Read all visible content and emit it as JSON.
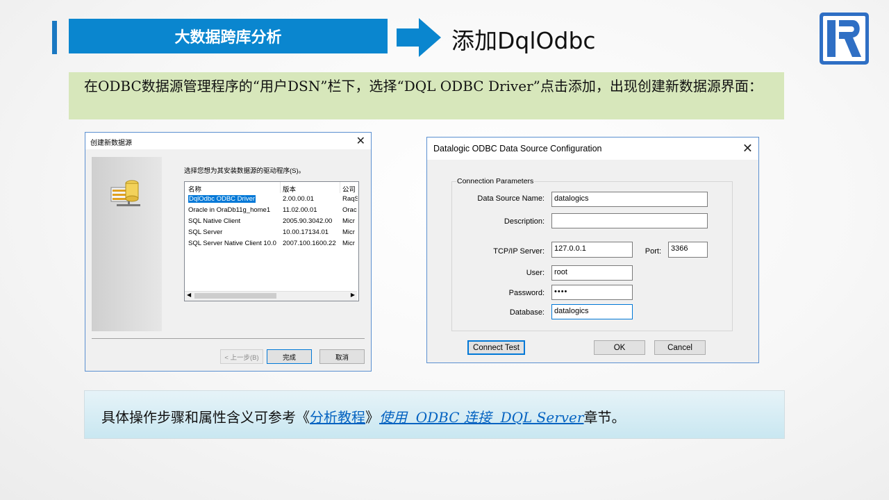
{
  "header": {
    "section_title": "大数据跨库分析",
    "slide_title": "添加DqlOdbc",
    "colors": {
      "accent": "#1a78c2",
      "banner": "#0a86cf",
      "logo": "#2f6fc4"
    }
  },
  "instruction": {
    "text": "在ODBC数据源管理程序的“用户DSN”栏下，选择“DQL ODBC Driver”点击添加，出现创建新数据源界面："
  },
  "new_datasource_dialog": {
    "title": "创建新数据源",
    "prompt": "选择您想为其安装数据源的驱动程序(S)。",
    "columns": [
      "名称",
      "版本",
      "公司"
    ],
    "drivers": [
      {
        "name": "DqlOdbc ODBC Driver",
        "version": "2.00.00.01",
        "company": "RaqS"
      },
      {
        "name": "Oracle in OraDb11g_home1",
        "version": "11.02.00.01",
        "company": "Orac"
      },
      {
        "name": "SQL Native Client",
        "version": "2005.90.3042.00",
        "company": "Micr"
      },
      {
        "name": "SQL Server",
        "version": "10.00.17134.01",
        "company": "Micr"
      },
      {
        "name": "SQL Server Native Client 10.0",
        "version": "2007.100.1600.22",
        "company": "Micr"
      }
    ],
    "back_label": "< 上一步(B)",
    "finish_label": "完成",
    "cancel_label": "取消",
    "icons": [
      "database-setup-icon",
      "close-icon",
      "scroll-left-icon",
      "scroll-right-icon"
    ]
  },
  "odbc_config_dialog": {
    "title": "Datalogic ODBC Data Source Configuration",
    "group_label": "Connection Parameters",
    "fields": {
      "dsn_label": "Data Source Name:",
      "dsn_value": "datalogics",
      "description_label": "Description:",
      "description_value": "",
      "tcpip_label": "TCP/IP Server:",
      "tcpip_value": "127.0.0.1",
      "port_label": "Port:",
      "port_value": "3366",
      "user_label": "User:",
      "user_value": "root",
      "password_label": "Password:",
      "password_value": "••••",
      "database_label": "Database:",
      "database_value": "datalogics"
    },
    "connect_test_label": "Connect Test",
    "ok_label": "OK",
    "cancel_label": "Cancel"
  },
  "note": {
    "prefix": "具体操作步骤和属性含义可参考《",
    "link1": "分析教程",
    "middle": "》",
    "link2": "使用  ODBC 连接  DQL Server",
    "suffix": "章节。"
  }
}
